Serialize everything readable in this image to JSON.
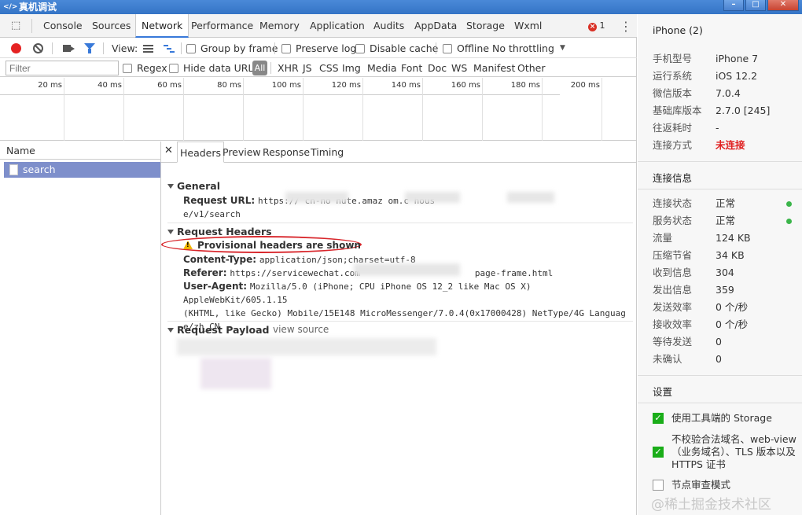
{
  "window": {
    "title": "真机调试",
    "icon": "code-icon"
  },
  "tabs": [
    {
      "label": "Console"
    },
    {
      "label": "Sources"
    },
    {
      "label": "Network"
    },
    {
      "label": "Performance"
    },
    {
      "label": "Memory"
    },
    {
      "label": "Application"
    },
    {
      "label": "Audits"
    },
    {
      "label": "AppData"
    },
    {
      "label": "Storage"
    },
    {
      "label": "Wxml"
    }
  ],
  "error_count": "1",
  "toolbar": {
    "view_label": "View:",
    "group_by_frame": "Group by frame",
    "preserve_log": "Preserve log",
    "disable_cache": "Disable cache",
    "offline": "Offline",
    "throttling": "No throttling"
  },
  "filter": {
    "placeholder": "Filter",
    "regex": "Regex",
    "hide_data_urls": "Hide data URLs",
    "all": "All",
    "types": [
      "XHR",
      "JS",
      "CSS",
      "Img",
      "Media",
      "Font",
      "Doc",
      "WS",
      "Manifest",
      "Other"
    ]
  },
  "timeline_ticks": [
    "20 ms",
    "40 ms",
    "60 ms",
    "80 ms",
    "100 ms",
    "120 ms",
    "140 ms",
    "160 ms",
    "180 ms",
    "200 ms"
  ],
  "requests": {
    "header": "Name",
    "items": [
      {
        "name": "search"
      }
    ]
  },
  "detail": {
    "tabs": [
      "Headers",
      "Preview",
      "Response",
      "Timing"
    ],
    "general": {
      "title": "General",
      "request_url_label": "Request URL:",
      "request_url_line1": "https://                    cn-no          nute.amaz          om.c    hous",
      "request_url_line2": "e/v1/search"
    },
    "request_headers": {
      "title": "Request Headers",
      "warning": "Provisional headers are shown",
      "content_type_label": "Content-Type:",
      "content_type_value": "application/json;charset=utf-8",
      "referer_label": "Referer:",
      "referer_value_a": "https://servicewechat.com",
      "referer_value_b": "page-frame.html",
      "user_agent_label": "User-Agent:",
      "user_agent_line1": "Mozilla/5.0 (iPhone; CPU iPhone OS 12_2 like Mac OS X) AppleWebKit/605.1.15",
      "user_agent_line2": " (KHTML, like Gecko) Mobile/15E148 MicroMessenger/7.0.4(0x17000428) NetType/4G Languag",
      "user_agent_line3": "e/zh_CN"
    },
    "request_payload": {
      "title": "Request Payload",
      "view_source": "view source"
    }
  },
  "device": {
    "title": "iPhone (2)",
    "info": [
      {
        "key": "手机型号",
        "value": "iPhone 7"
      },
      {
        "key": "运行系统",
        "value": "iOS 12.2"
      },
      {
        "key": "微信版本",
        "value": "7.0.4"
      },
      {
        "key": "基础库版本",
        "value": "2.7.0 [245]"
      },
      {
        "key": "往返耗时",
        "value": "-"
      },
      {
        "key": "连接方式",
        "value": "未连接"
      }
    ]
  },
  "connection": {
    "title": "连接信息",
    "rows": [
      {
        "key": "连接状态",
        "value": "正常"
      },
      {
        "key": "服务状态",
        "value": "正常"
      },
      {
        "key": "流量",
        "value": "124 KB"
      },
      {
        "key": "压缩节省",
        "value": "34 KB"
      },
      {
        "key": "收到信息",
        "value": "304"
      },
      {
        "key": "发出信息",
        "value": "359"
      },
      {
        "key": "发送效率",
        "value": "0 个/秒"
      },
      {
        "key": "接收效率",
        "value": "0 个/秒"
      },
      {
        "key": "等待发送",
        "value": "0"
      },
      {
        "key": "未确认",
        "value": "0"
      }
    ]
  },
  "settings": {
    "title": "设置",
    "items": [
      {
        "label": "使用工具端的 Storage",
        "checked": true
      },
      {
        "label": "不校验合法域名、web-view（业务域名）、TLS 版本以及 HTTPS 证书",
        "checked": true
      },
      {
        "label": "节点审查模式",
        "checked": false
      }
    ]
  },
  "watermark": "@稀土掘金技术社区",
  "colors": {
    "accent": "#3879d9",
    "record": "#e52222",
    "selected_row": "#7e8fcb",
    "ok": "#3bb54a",
    "error": "#e02020",
    "wechat_green": "#1aad19"
  }
}
